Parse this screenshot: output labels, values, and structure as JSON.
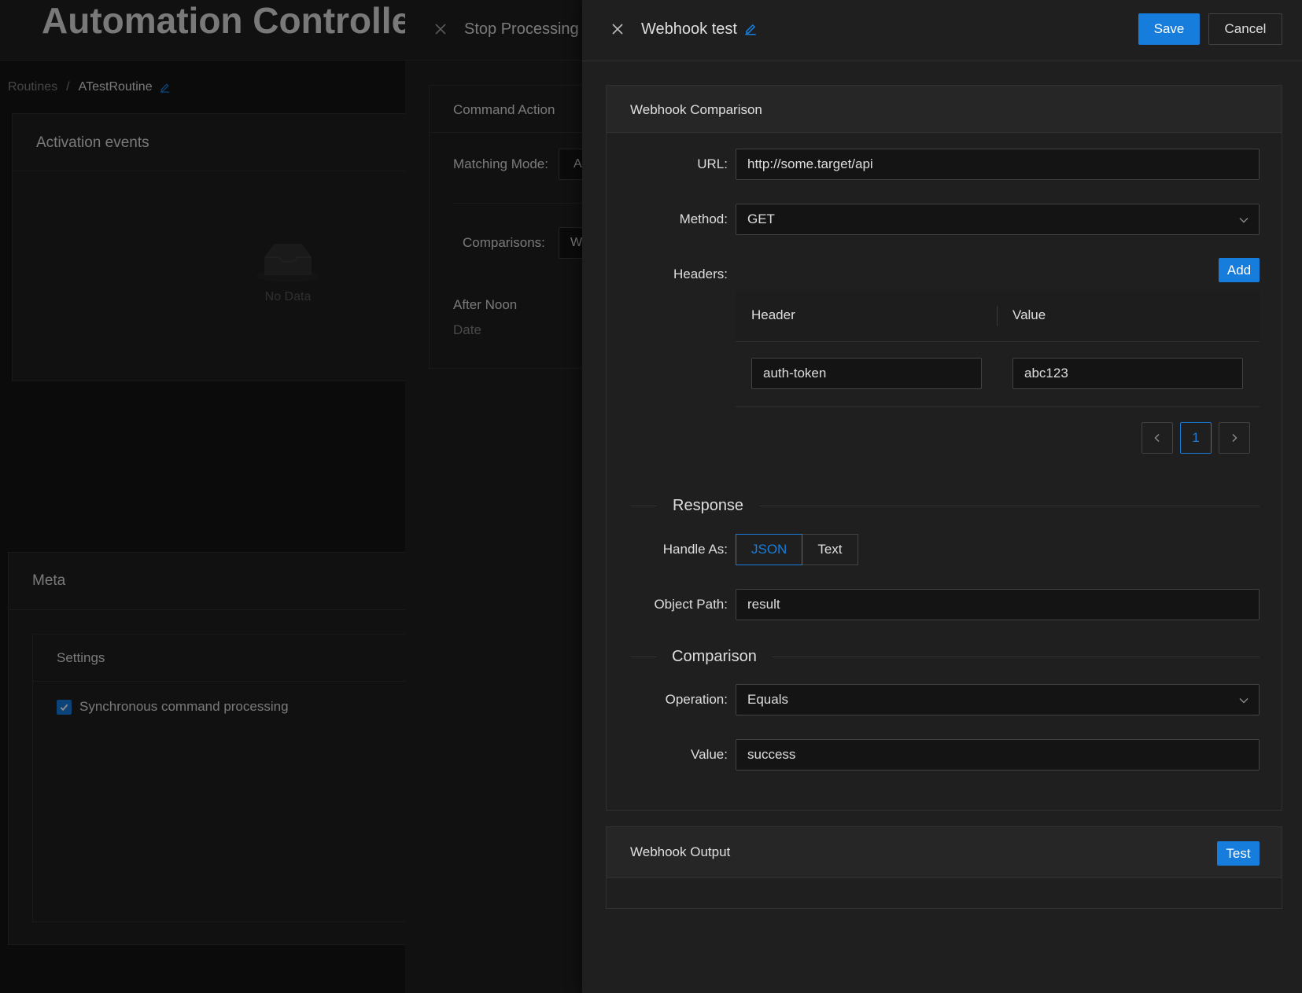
{
  "app": {
    "title": "Automation Controller"
  },
  "breadcrumb": {
    "items": [
      "Routines",
      "ATestRoutine"
    ],
    "separator": "/"
  },
  "activation_events": {
    "title": "Activation events",
    "empty_text": "No Data"
  },
  "meta": {
    "title": "Meta",
    "settings_title": "Settings",
    "synchronous_label": "Synchronous command processing",
    "synchronous_checked": true
  },
  "drawer_stop": {
    "title": "Stop Processing",
    "section_title": "Command Action",
    "matching_mode_label": "Matching Mode",
    "matching_mode_value": "A",
    "comparisons_label": "Comparisons",
    "comparisons_value": "W",
    "item_title": "After Noon",
    "item_subtitle": "Date"
  },
  "drawer_webhook": {
    "title": "Webhook test",
    "save_label": "Save",
    "cancel_label": "Cancel",
    "comparison_section": {
      "title": "Webhook Comparison",
      "url_label": "URL",
      "url_value": "http://some.target/api",
      "method_label": "Method",
      "method_value": "GET",
      "headers_label": "Headers",
      "add_label": "Add",
      "table_columns": [
        "Header",
        "Value"
      ],
      "rows": [
        {
          "header": "auth-token",
          "value": "abc123"
        }
      ],
      "current_page": "1",
      "response_title": "Response",
      "handle_as_label": "Handle As",
      "handle_as_options": [
        "JSON",
        "Text"
      ],
      "handle_as_selected": "JSON",
      "object_path_label": "Object Path",
      "object_path_value": "result",
      "comparison_title": "Comparison",
      "operation_label": "Operation",
      "operation_value": "Equals",
      "value_label": "Value",
      "value_value": "success"
    },
    "output_section": {
      "title": "Webhook Output",
      "test_label": "Test"
    }
  },
  "colors": {
    "accent": "#177ddc",
    "background": "#141414",
    "panel": "#1f1f1f",
    "border": "#303030"
  }
}
